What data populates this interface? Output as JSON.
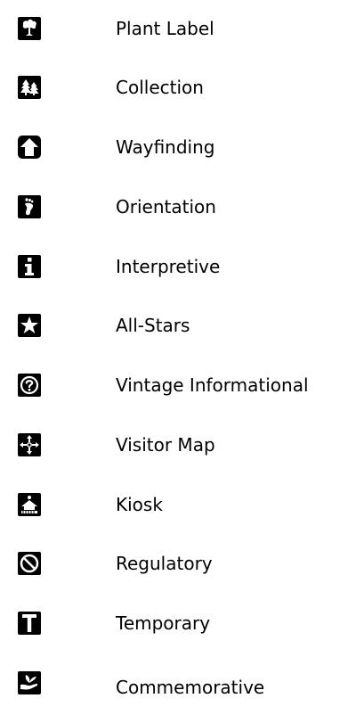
{
  "legend": {
    "items": [
      {
        "label": "Plant Label",
        "icon": "tree-icon"
      },
      {
        "label": "Collection",
        "icon": "evergreen-trees-icon"
      },
      {
        "label": "Wayfinding",
        "icon": "up-arrow-icon"
      },
      {
        "label": "Orientation",
        "icon": "footprint-icon"
      },
      {
        "label": "Interpretive",
        "icon": "info-icon"
      },
      {
        "label": "All-Stars",
        "icon": "star-icon"
      },
      {
        "label": "Vintage Informational",
        "icon": "question-circle-icon"
      },
      {
        "label": "Visitor Map",
        "icon": "compass-arrows-icon"
      },
      {
        "label": "Kiosk",
        "icon": "kiosk-icon"
      },
      {
        "label": "Regulatory",
        "icon": "prohibited-icon"
      },
      {
        "label": "Temporary",
        "icon": "letter-t-icon"
      },
      {
        "label": "Commemorative",
        "icon": "hand-plant-icon"
      }
    ]
  },
  "colors": {
    "icon_fill": "#000000",
    "icon_glyph": "#ffffff",
    "text": "#000000",
    "background": "#ffffff"
  }
}
